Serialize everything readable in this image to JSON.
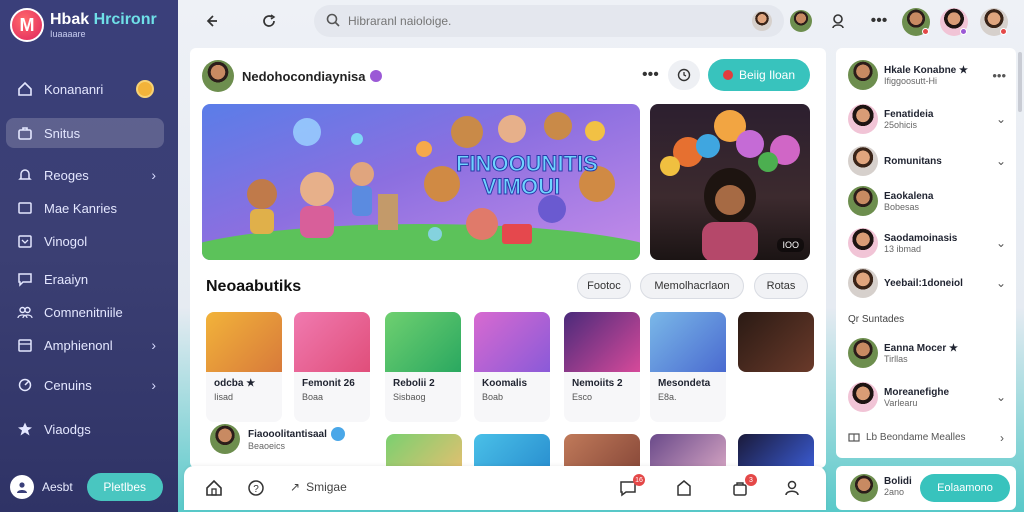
{
  "brand": {
    "title": "Hbak",
    "title_accent": "Hrcironr",
    "superscript": "TO",
    "subtitle": "Iuaaaare"
  },
  "sidebar": {
    "items": [
      {
        "label": "Konananri",
        "icon": "home-icon"
      },
      {
        "label": "Snitus",
        "icon": "briefcase-icon"
      },
      {
        "label": "Reoges",
        "icon": "bell-icon"
      },
      {
        "label": "Mae Kanries",
        "icon": "tv-icon"
      },
      {
        "label": "Vinogol",
        "icon": "calendar-icon"
      },
      {
        "label": "Eraaiyn",
        "icon": "chat-icon"
      },
      {
        "label": "Comnenitniile",
        "icon": "people-icon"
      },
      {
        "label": "Amphienonl",
        "icon": "chart-icon"
      },
      {
        "label": "Cenuins",
        "icon": "location-icon"
      },
      {
        "label": "Viaodgs",
        "icon": "star-icon"
      }
    ],
    "bottom_label": "Aesbt",
    "bottom_button": "Pletlbes"
  },
  "topbar": {
    "search_placeholder": "Hibraranl naioloige."
  },
  "post": {
    "author": "Nedohocondiaynisa",
    "primary_button": "Beiig Iloan",
    "banner_title_line1": "FINOOUNITIS",
    "banner_title_line2": "VIMOUI",
    "side_media_chip": "IOO"
  },
  "section": {
    "title": "Neoaabutiks",
    "chips": [
      "Footoc",
      "Memolhacrlaon",
      "Rotas"
    ]
  },
  "tiles": [
    {
      "title": "odcba ★",
      "sub": "Iisad"
    },
    {
      "title": "Femonit 26",
      "sub": "Boaa"
    },
    {
      "title": "Rebolii 2",
      "sub": "Sisbaog"
    },
    {
      "title": "Koomalis",
      "sub": "Boab"
    },
    {
      "title": "Nemoiits 2",
      "sub": "Esco"
    },
    {
      "title": "Mesondeta",
      "sub": "E8a."
    },
    {
      "title": "",
      "sub": ""
    }
  ],
  "mini_user": {
    "name": "Fiaooolitantisaal",
    "sub": "Beaoeics"
  },
  "bottombar": {
    "link_label": "Smigae",
    "badge1": "16",
    "badge2": "3"
  },
  "rpanel": {
    "rows": [
      {
        "name": "Hkale Konabne ★",
        "sub": "Ifiggoosutt-Hi"
      },
      {
        "name": "Fenatideia",
        "sub": "25ohicis"
      },
      {
        "name": "Romunitans",
        "sub": ""
      },
      {
        "name": "Eaokalena",
        "sub": "Bobesas"
      },
      {
        "name": "Saodamoinasis",
        "sub": "13 ibmad"
      },
      {
        "name": "Yeebail:1doneiol",
        "sub": ""
      }
    ],
    "section_label": "Qr Suntades",
    "rows2": [
      {
        "name": "Eanna Mocer ★",
        "sub": "Tirllas"
      },
      {
        "name": "Moreanefighe",
        "sub": "Varlearu"
      }
    ],
    "footer": "Lb Beondame Mealles"
  },
  "rbottom": {
    "name": "Bolidi",
    "sub": "2ano",
    "button": "Eolaamono"
  }
}
